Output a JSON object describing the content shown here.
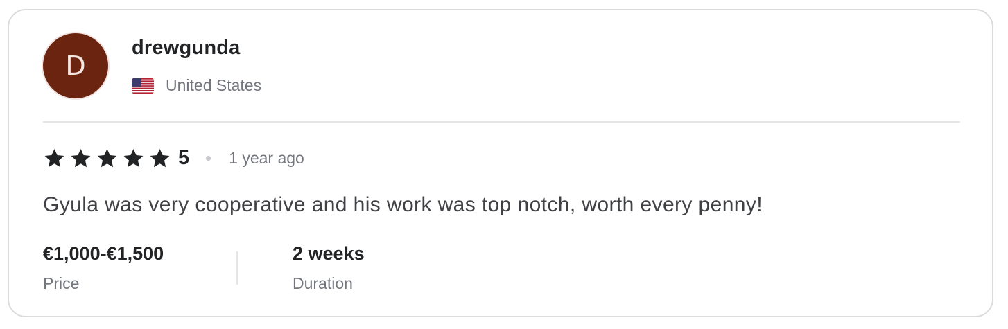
{
  "review": {
    "user": {
      "initial": "D",
      "username": "drewgunda",
      "country": "United States",
      "flag_icon": "us-flag-icon"
    },
    "rating": {
      "stars": 5,
      "max_stars": 5,
      "value_label": "5",
      "time_ago": "1 year ago"
    },
    "text": "Gyula was very cooperative and his work was top notch, worth every penny!",
    "price": {
      "value": "€1,000-€1,500",
      "label": "Price"
    },
    "duration": {
      "value": "2 weeks",
      "label": "Duration"
    }
  },
  "colors": {
    "avatar_bg": "#6b2410",
    "star": "#222325",
    "muted_text": "#74767e",
    "border": "#dadbdd"
  }
}
